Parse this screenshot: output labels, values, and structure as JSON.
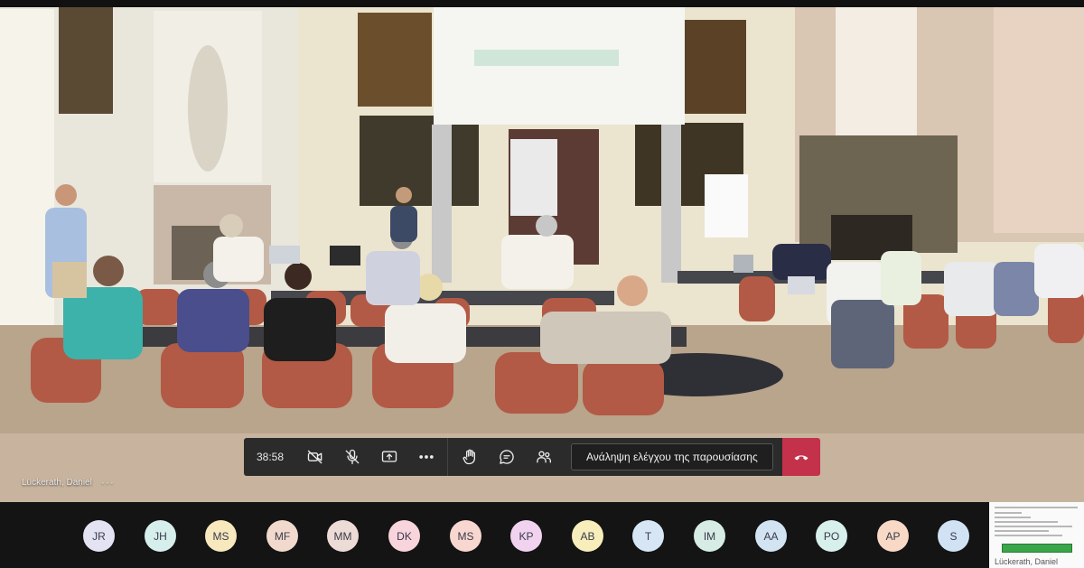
{
  "meeting": {
    "timer": "38:58",
    "present_control_label": "Ανάληψη ελέγχου της παρουσίασης",
    "speaker_name": "Lückerath, Daniel",
    "speaker_more": "···"
  },
  "controls": [
    {
      "icon": "camera-off-icon"
    },
    {
      "icon": "mic-off-icon"
    },
    {
      "icon": "share-screen-icon"
    },
    {
      "icon": "more-options-icon"
    },
    {
      "icon": "raise-hand-icon"
    },
    {
      "icon": "chat-icon"
    },
    {
      "icon": "participants-icon"
    }
  ],
  "colors": {
    "hangup": "#c4314b",
    "control_bg": "#2b2b2b",
    "participants_bg": "#141414"
  },
  "participants": [
    {
      "initials": "JR",
      "color": "#e3e3f3"
    },
    {
      "initials": "JH",
      "color": "#d6efec"
    },
    {
      "initials": "MS",
      "color": "#f8e8bd"
    },
    {
      "initials": "MF",
      "color": "#f2d9cd"
    },
    {
      "initials": "MM",
      "color": "#ecdcd5"
    },
    {
      "initials": "DK",
      "color": "#f8d4dd"
    },
    {
      "initials": "MS",
      "color": "#f7d7cf"
    },
    {
      "initials": "KP",
      "color": "#f1d3f0"
    },
    {
      "initials": "AB",
      "color": "#f8eebc"
    },
    {
      "initials": "T",
      "color": "#d6e6f4"
    },
    {
      "initials": "IM",
      "color": "#d6ece4"
    },
    {
      "initials": "AA",
      "color": "#d2e3f1"
    },
    {
      "initials": "PO",
      "color": "#d8f0ec"
    },
    {
      "initials": "AP",
      "color": "#f7d9c5"
    },
    {
      "initials": "S",
      "color": "#d2e2f5"
    }
  ],
  "thumbnail": {
    "name": "Lückerath, Daniel"
  }
}
